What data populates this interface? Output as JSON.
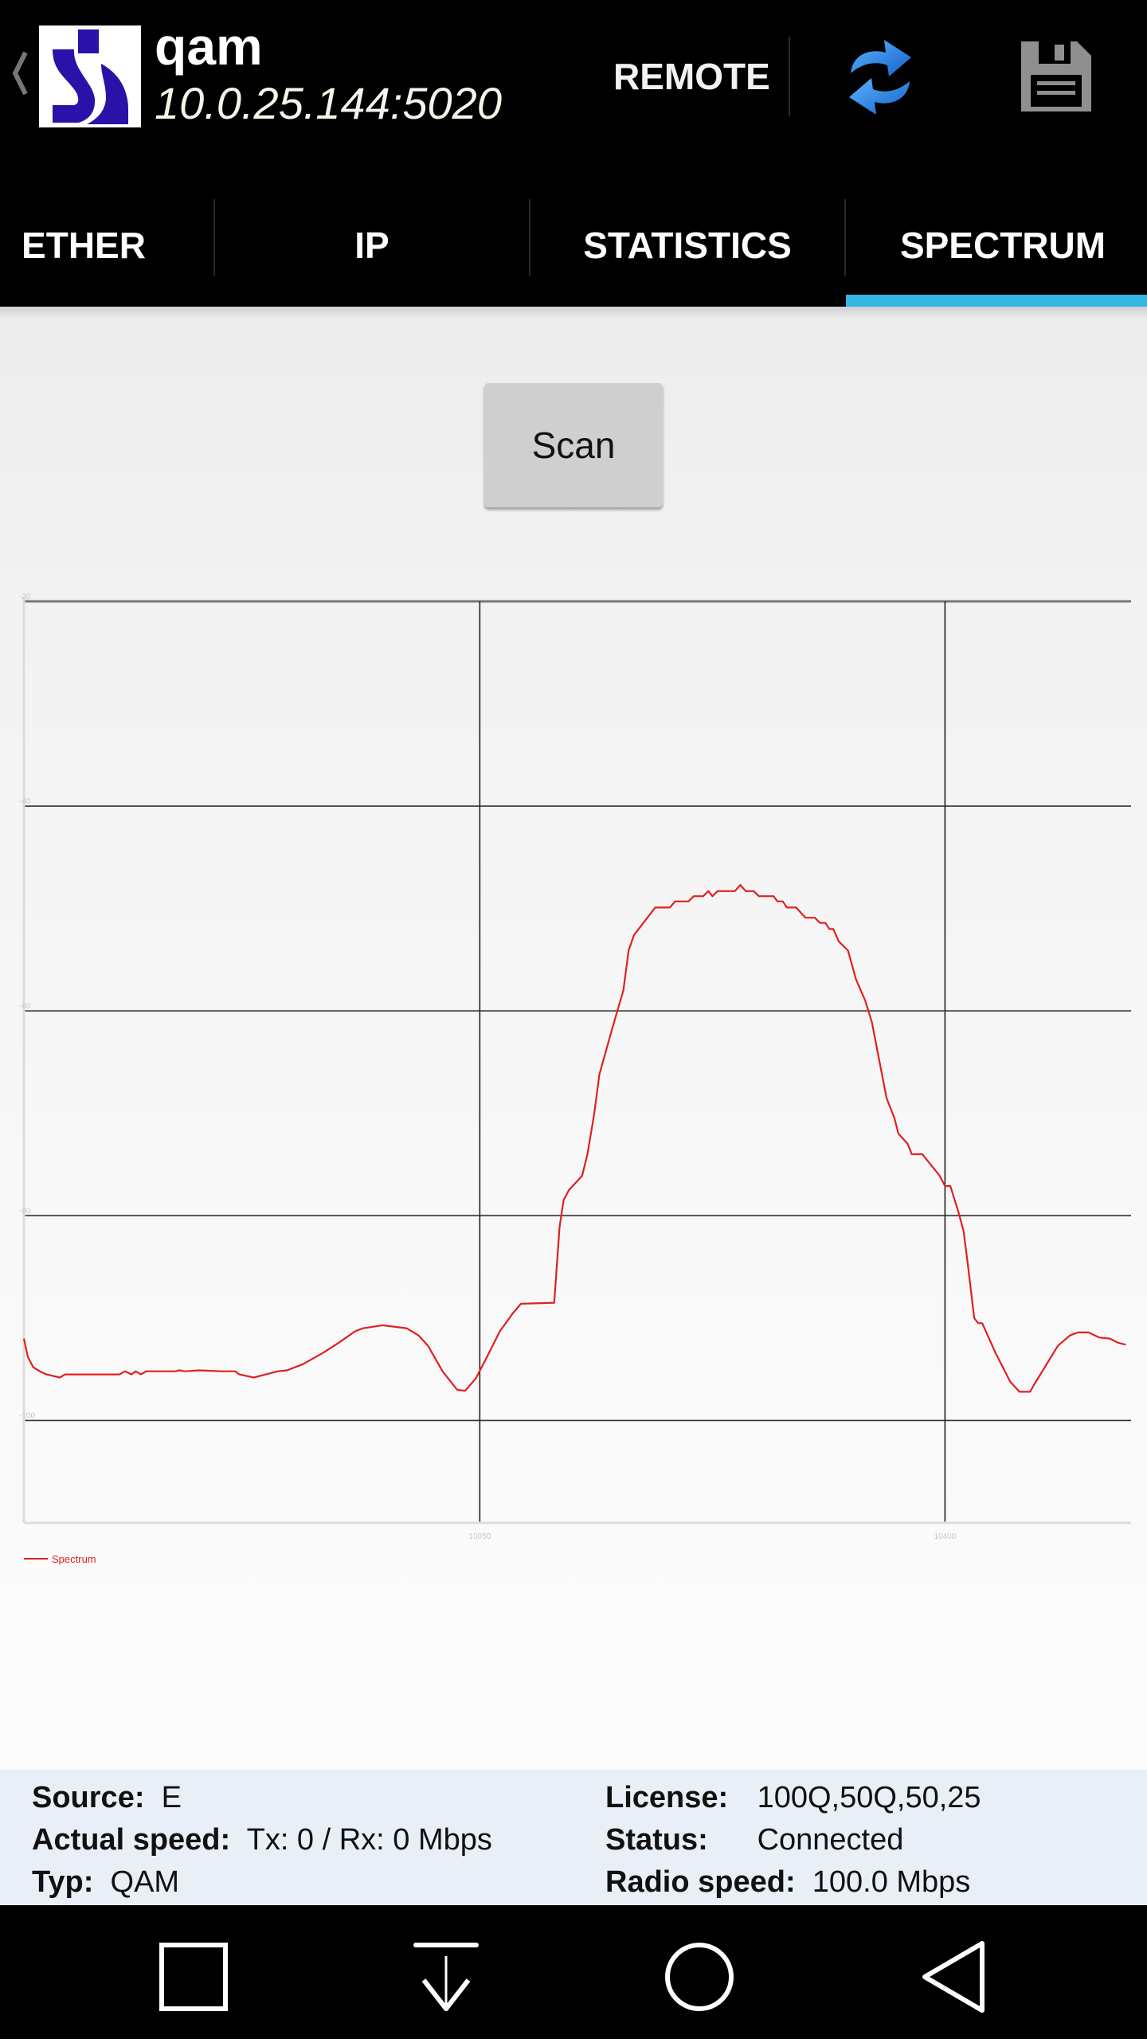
{
  "header": {
    "title": "qam",
    "address": "10.0.25.144:5020",
    "remote_label": "REMOTE",
    "icons": [
      "back-chevron-icon",
      "app-logo-icon",
      "refresh-icon",
      "save-icon"
    ]
  },
  "tabs": [
    {
      "label": "ETHER",
      "active": false
    },
    {
      "label": "IP",
      "active": false
    },
    {
      "label": "STATISTICS",
      "active": false
    },
    {
      "label": "SPECTRUM",
      "active": true
    }
  ],
  "colors": {
    "tab_indicator": "#33b5e5",
    "series": "#e02020",
    "info_bg": "#e9eff7"
  },
  "scan_button": {
    "label": "Scan"
  },
  "chart_data": {
    "type": "line",
    "title": "",
    "xlabel": "",
    "ylabel": "",
    "xlim": [
      9707,
      10540
    ],
    "ylim": [
      -110,
      -20
    ],
    "x_ticks": [
      {
        "value": 10050,
        "label": "10050"
      },
      {
        "value": 10400,
        "label": "10400"
      }
    ],
    "y_ticks": [
      {
        "value": -20,
        "label": "-20"
      },
      {
        "value": -40,
        "label": "-40"
      },
      {
        "value": -60,
        "label": "-60"
      },
      {
        "value": -80,
        "label": "-80"
      },
      {
        "value": -100,
        "label": "-100"
      }
    ],
    "grid": true,
    "legend": {
      "position": "bottom-left",
      "entries": [
        "Spectrum"
      ]
    },
    "series": [
      {
        "name": "Spectrum",
        "color": "#e02020",
        "x": [
          9707,
          9710,
          9714,
          9719,
          9724,
          9734,
          9738,
          9779,
          9783,
          9788,
          9791,
          9795,
          9799,
          9821,
          9824,
          9828,
          9839,
          9856,
          9866,
          9869,
          9880,
          9889,
          9898,
          9905,
          9917,
          9932,
          9944,
          9956,
          9962,
          9977,
          9995,
          10004,
          10011,
          10022,
          10033,
          10039,
          10047,
          10055,
          10065,
          10075,
          10081,
          10106,
          10110,
          10113,
          10117,
          10127,
          10131,
          10136,
          10140,
          10151,
          10158,
          10162,
          10166,
          10182,
          10193,
          10197,
          10207,
          10211,
          10218,
          10222,
          10225,
          10229,
          10242,
          10246,
          10250,
          10256,
          10260,
          10271,
          10274,
          10278,
          10281,
          10288,
          10295,
          10302,
          10306,
          10310,
          10313,
          10316,
          10320,
          10327,
          10333,
          10340,
          10345,
          10356,
          10362,
          10365,
          10372,
          10375,
          10383,
          10396,
          10400,
          10404,
          10410,
          10414,
          10417,
          10422,
          10425,
          10428,
          10438,
          10449,
          10456,
          10464,
          10467,
          10485,
          10494,
          10500,
          10508,
          10516,
          10524,
          10530,
          10536
        ],
        "y": [
          -92.0,
          -93.8,
          -94.8,
          -95.2,
          -95.5,
          -95.8,
          -95.5,
          -95.5,
          -95.2,
          -95.5,
          -95.2,
          -95.5,
          -95.2,
          -95.2,
          -95.1,
          -95.2,
          -95.1,
          -95.2,
          -95.2,
          -95.5,
          -95.8,
          -95.5,
          -95.2,
          -95.1,
          -94.5,
          -93.4,
          -92.4,
          -91.3,
          -91.0,
          -90.7,
          -91.0,
          -91.7,
          -92.7,
          -95.2,
          -97.0,
          -97.1,
          -95.9,
          -93.9,
          -91.3,
          -89.5,
          -88.6,
          -88.5,
          -81.1,
          -78.5,
          -77.5,
          -76.1,
          -74.0,
          -70.1,
          -66.2,
          -61.1,
          -58.0,
          -54.1,
          -52.6,
          -49.9,
          -49.9,
          -49.3,
          -49.3,
          -48.8,
          -48.8,
          -48.3,
          -48.8,
          -48.3,
          -48.3,
          -47.7,
          -48.3,
          -48.3,
          -48.8,
          -48.8,
          -49.3,
          -49.3,
          -49.9,
          -49.9,
          -50.9,
          -50.9,
          -51.4,
          -51.4,
          -52.0,
          -52.0,
          -53.2,
          -54.1,
          -56.9,
          -59.0,
          -61.1,
          -68.5,
          -70.5,
          -72.0,
          -73.0,
          -74.0,
          -74.0,
          -76.1,
          -77.1,
          -77.1,
          -79.6,
          -81.5,
          -84.6,
          -90.0,
          -90.5,
          -90.5,
          -93.4,
          -96.2,
          -97.2,
          -97.2,
          -96.5,
          -92.7,
          -91.7,
          -91.4,
          -91.4,
          -91.9,
          -92.0,
          -92.4,
          -92.6
        ]
      }
    ]
  },
  "info": {
    "source": {
      "label": "Source:",
      "value": "E"
    },
    "actual_speed": {
      "label": "Actual speed:",
      "value": "Tx: 0 / Rx: 0 Mbps"
    },
    "typ": {
      "label": "Typ:",
      "value": "QAM"
    },
    "license": {
      "label": "License:",
      "value": "100Q,50Q,50,25"
    },
    "status": {
      "label": "Status:",
      "value": "Connected"
    },
    "radio_speed": {
      "label": "Radio speed:",
      "value": "100.0 Mbps"
    }
  },
  "navbar": {
    "icons": [
      "recents-icon",
      "notification-pull-icon",
      "home-icon",
      "back-icon"
    ]
  }
}
